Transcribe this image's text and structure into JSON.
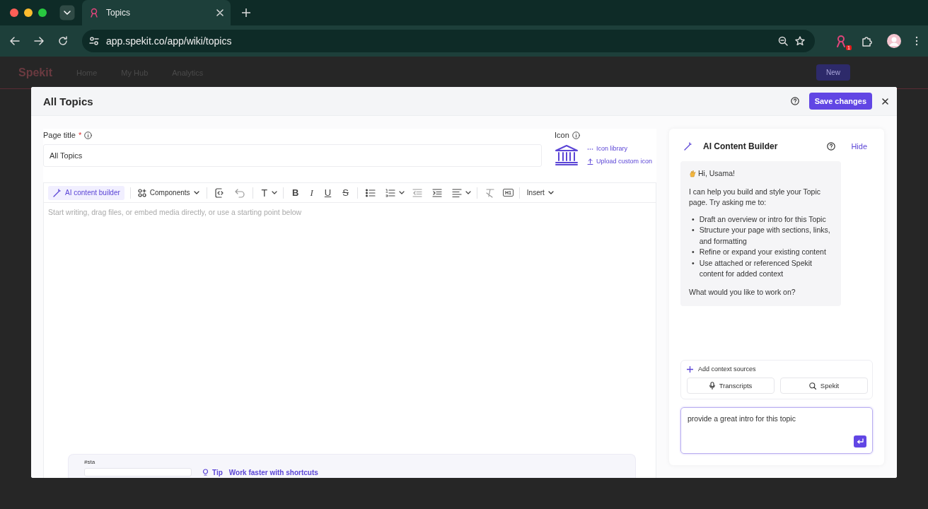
{
  "browser": {
    "tab_title": "Topics",
    "url": "app.spekit.co/app/wiki/topics",
    "extension_badge": "1"
  },
  "app_nav": {
    "logo": "Spekit",
    "items": [
      "Home",
      "My Hub",
      "Analytics"
    ],
    "new_button": "New"
  },
  "modal": {
    "title": "All Topics",
    "save_button": "Save changes"
  },
  "editor": {
    "page_title_label": "Page title",
    "required_mark": "*",
    "page_title_value": "All Topics",
    "icon_label": "Icon",
    "icon_links": [
      "Icon library",
      "Upload custom icon"
    ],
    "toolbar": {
      "ai_button": "AI content builder",
      "components": "Components",
      "insert": "Insert",
      "format_keys": [
        {
          "kind": "heading",
          "glyph": "T"
        },
        {
          "kind": "bold",
          "glyph": "B"
        },
        {
          "kind": "italic",
          "glyph": "I"
        },
        {
          "kind": "underline",
          "glyph": "U"
        },
        {
          "kind": "strike",
          "glyph": "S"
        }
      ],
      "h1_glyph": "H1"
    },
    "placeholder": "Start writing, drag files, or embed media directly, or use a starting point below",
    "snippet": "#sta",
    "tip_label": "Tip",
    "tip_text": "Work faster with shortcuts"
  },
  "ai_panel": {
    "title": "AI Content Builder",
    "hide": "Hide",
    "greeting": "Hi, Usama!",
    "intro": "I can help you build and style your Topic page. Try asking me to:",
    "bullets": [
      "Draft an overview or intro for this Topic",
      "Structure your page with sections, links, and formatting",
      "Refine or expand your existing content",
      "Use attached or referenced Spekit content for added context"
    ],
    "bullet_marker": "•",
    "question": "What would you like to work on?",
    "context_label": "Add context sources",
    "sources": [
      {
        "kind": "mic",
        "label": "Transcripts"
      },
      {
        "kind": "search",
        "label": "Spekit"
      }
    ],
    "input_value": "provide a great intro for this topic"
  }
}
